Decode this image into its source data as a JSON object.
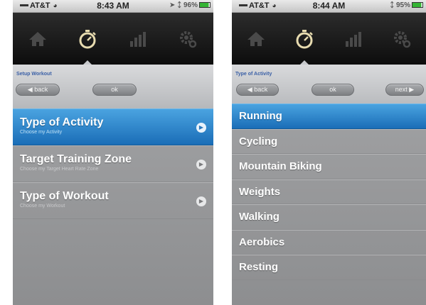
{
  "screens": [
    {
      "status": {
        "carrier": "AT&T",
        "time": "8:43 AM",
        "battery": "96%"
      },
      "tabs": [
        {
          "icon": "home-icon"
        },
        {
          "icon": "stopwatch-icon",
          "active": true
        },
        {
          "icon": "bar-chart-icon"
        },
        {
          "icon": "gear-icon"
        }
      ],
      "header": {
        "label": "Setup Workout",
        "back": "back",
        "ok": "ok"
      },
      "items": [
        {
          "title": "Type of Activity",
          "subtitle": "Choose my Activity",
          "selected": true
        },
        {
          "title": "Target Training Zone",
          "subtitle": "Choose my Target Heart Rate Zone"
        },
        {
          "title": "Type of Workout",
          "subtitle": "Choose my Workout"
        }
      ]
    },
    {
      "status": {
        "carrier": "AT&T",
        "time": "8:44 AM",
        "battery": "95%"
      },
      "tabs": [
        {
          "icon": "home-icon"
        },
        {
          "icon": "stopwatch-icon",
          "active": true
        },
        {
          "icon": "bar-chart-icon"
        },
        {
          "icon": "gear-icon"
        }
      ],
      "header": {
        "label": "Type of Activity",
        "back": "back",
        "ok": "ok",
        "next": "next"
      },
      "items": [
        {
          "title": "Running",
          "selected": true
        },
        {
          "title": "Cycling"
        },
        {
          "title": "Mountain Biking"
        },
        {
          "title": "Weights"
        },
        {
          "title": "Walking"
        },
        {
          "title": "Aerobics"
        },
        {
          "title": "Resting"
        }
      ]
    }
  ],
  "colors": {
    "selected": "#2a82cc",
    "tab_active": "#e8dcb0",
    "tab_inactive": "#4a4a4a",
    "label": "#3a5fa6"
  }
}
